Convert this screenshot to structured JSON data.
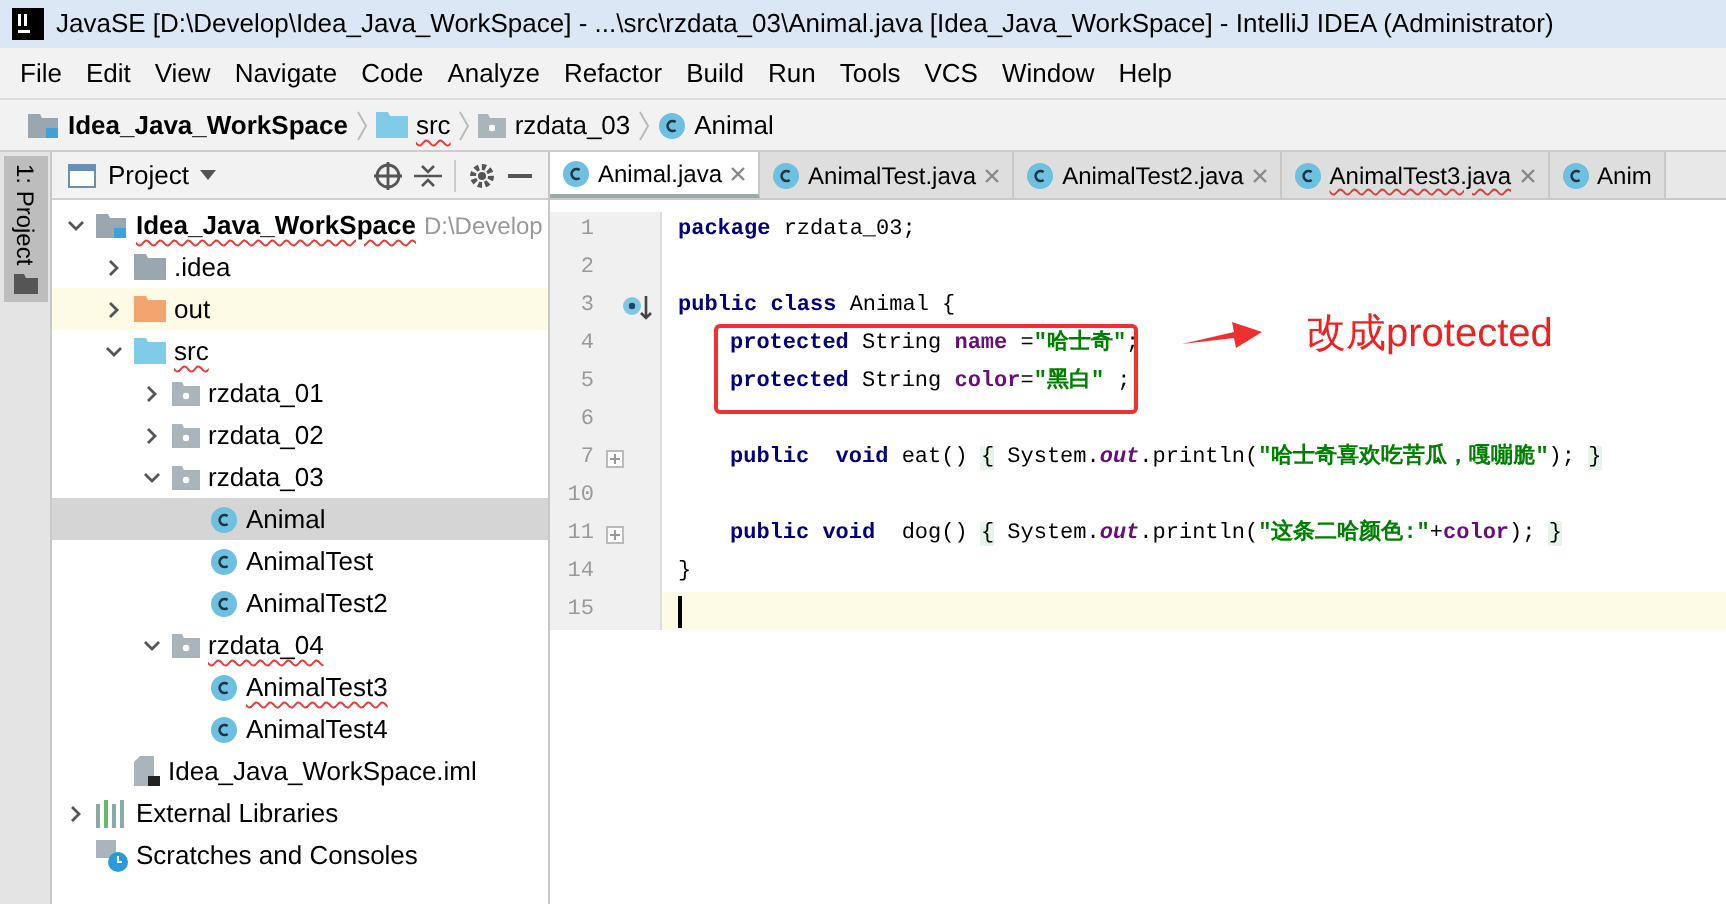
{
  "window": {
    "title": "JavaSE [D:\\Develop\\Idea_Java_WorkSpace] - ...\\src\\rzdata_03\\Animal.java [Idea_Java_WorkSpace] - IntelliJ IDEA (Administrator)"
  },
  "menu": [
    "File",
    "Edit",
    "View",
    "Navigate",
    "Code",
    "Analyze",
    "Refactor",
    "Build",
    "Run",
    "Tools",
    "VCS",
    "Window",
    "Help"
  ],
  "breadcrumb": [
    {
      "kind": "module",
      "label": "Idea_Java_WorkSpace",
      "error": false
    },
    {
      "kind": "src",
      "label": "src",
      "error": true
    },
    {
      "kind": "package",
      "label": "rzdata_03",
      "error": false
    },
    {
      "kind": "class",
      "label": "Animal",
      "error": false
    }
  ],
  "tool_stripe": {
    "label": "1: Project"
  },
  "project_panel": {
    "title": "Project"
  },
  "tree": [
    {
      "kind": "module",
      "label": "Idea_Java_WorkSpace",
      "hint": "D:\\Develop",
      "error": true,
      "expanded": true,
      "selected": false,
      "highlighted": false,
      "children": [
        {
          "kind": "folder",
          "label": ".idea",
          "error": false,
          "expanded": false,
          "selected": false,
          "highlighted": false
        },
        {
          "kind": "out",
          "label": "out",
          "error": false,
          "expanded": false,
          "selected": false,
          "highlighted": true
        },
        {
          "kind": "src",
          "label": "src",
          "error": true,
          "expanded": true,
          "selected": false,
          "highlighted": false,
          "children": [
            {
              "kind": "package",
              "label": "rzdata_01",
              "error": false,
              "expanded": false,
              "selected": false,
              "highlighted": false
            },
            {
              "kind": "package",
              "label": "rzdata_02",
              "error": false,
              "expanded": false,
              "selected": false,
              "highlighted": false
            },
            {
              "kind": "package",
              "label": "rzdata_03",
              "error": false,
              "expanded": true,
              "selected": false,
              "highlighted": false,
              "children": [
                {
                  "kind": "class",
                  "label": "Animal",
                  "error": false,
                  "selected": true,
                  "highlighted": false
                },
                {
                  "kind": "class",
                  "label": "AnimalTest",
                  "error": false,
                  "selected": false,
                  "highlighted": false
                },
                {
                  "kind": "class",
                  "label": "AnimalTest2",
                  "error": false,
                  "selected": false,
                  "highlighted": false
                }
              ]
            },
            {
              "kind": "package",
              "label": "rzdata_04",
              "error": true,
              "expanded": true,
              "selected": false,
              "highlighted": false,
              "children": [
                {
                  "kind": "class",
                  "label": "AnimalTest3",
                  "error": true,
                  "selected": false,
                  "highlighted": false
                },
                {
                  "kind": "class",
                  "label": "AnimalTest4",
                  "error": false,
                  "selected": false,
                  "highlighted": false
                }
              ]
            }
          ]
        },
        {
          "kind": "iml",
          "label": "Idea_Java_WorkSpace.iml",
          "error": false,
          "selected": false,
          "highlighted": false
        }
      ]
    },
    {
      "kind": "libraries",
      "label": "External Libraries",
      "error": false,
      "expanded": false,
      "selected": false,
      "highlighted": false
    },
    {
      "kind": "scratches",
      "label": "Scratches and Consoles",
      "error": false,
      "selected": false,
      "highlighted": false
    }
  ],
  "tabs": [
    {
      "label": "Animal.java",
      "selected": true,
      "error": false,
      "closable": true
    },
    {
      "label": "AnimalTest.java",
      "selected": false,
      "error": false,
      "closable": true
    },
    {
      "label": "AnimalTest2.java",
      "selected": false,
      "error": false,
      "closable": true
    },
    {
      "label": "AnimalTest3.java",
      "selected": false,
      "error": true,
      "closable": true
    },
    {
      "label": "Anim",
      "selected": false,
      "error": false,
      "closable": false
    }
  ],
  "code": [
    {
      "num": "1",
      "current": false,
      "tokens": [
        {
          "kind": "kw",
          "text": "package"
        },
        {
          "kind": "plain",
          "text": " rzdata_03;"
        }
      ]
    },
    {
      "num": "2",
      "current": false
    },
    {
      "num": "3",
      "marker": true,
      "current": false,
      "tokens": [
        {
          "kind": "kw",
          "text": "public class"
        },
        {
          "kind": "plain",
          "text": " Animal {"
        }
      ]
    },
    {
      "num": "4",
      "indented": true,
      "current": false,
      "tokens": [
        {
          "kind": "kw",
          "text": "protected"
        },
        {
          "kind": "plain",
          "text": " String "
        },
        {
          "kind": "field",
          "text": "name"
        },
        {
          "kind": "plain",
          "text": " ="
        },
        {
          "kind": "str",
          "text": "\"哈士奇\""
        },
        {
          "kind": "plain",
          "text": ";"
        }
      ]
    },
    {
      "num": "5",
      "indented": true,
      "current": false,
      "tokens": [
        {
          "kind": "kw",
          "text": "protected"
        },
        {
          "kind": "plain",
          "text": " String "
        },
        {
          "kind": "field",
          "text": "color"
        },
        {
          "kind": "plain",
          "text": "="
        },
        {
          "kind": "str",
          "text": "\"黑白\""
        },
        {
          "kind": "plain",
          "text": " ;"
        }
      ]
    },
    {
      "num": "6",
      "current": false
    },
    {
      "num": "7",
      "fold": true,
      "indented": true,
      "current": false,
      "tokens": [
        {
          "kind": "kw",
          "text": "public  void"
        },
        {
          "kind": "plain",
          "text": " eat() "
        },
        {
          "kind": "brace",
          "text": "{"
        },
        {
          "kind": "plain",
          "text": " System."
        },
        {
          "kind": "static",
          "text": "out"
        },
        {
          "kind": "plain",
          "text": ".println("
        },
        {
          "kind": "str",
          "text": "\"哈士奇喜欢吃苦瓜，嘎嘣脆\""
        },
        {
          "kind": "plain",
          "text": "); "
        },
        {
          "kind": "brace",
          "text": "}"
        }
      ]
    },
    {
      "num": "10",
      "current": false
    },
    {
      "num": "11",
      "fold": true,
      "indented": true,
      "current": false,
      "tokens": [
        {
          "kind": "kw",
          "text": "public void"
        },
        {
          "kind": "plain",
          "text": "  dog() "
        },
        {
          "kind": "brace",
          "text": "{"
        },
        {
          "kind": "plain",
          "text": " System."
        },
        {
          "kind": "static",
          "text": "out"
        },
        {
          "kind": "plain",
          "text": ".println("
        },
        {
          "kind": "str",
          "text": "\"这条二哈颜色:\""
        },
        {
          "kind": "plain",
          "text": "+"
        },
        {
          "kind": "field",
          "text": "color"
        },
        {
          "kind": "plain",
          "text": "); "
        },
        {
          "kind": "brace",
          "text": "}"
        }
      ]
    },
    {
      "num": "14",
      "current": false,
      "tokens": [
        {
          "kind": "plain",
          "text": "}"
        }
      ]
    },
    {
      "num": "15",
      "current": true
    }
  ],
  "annotation": {
    "text": "改成protected"
  }
}
